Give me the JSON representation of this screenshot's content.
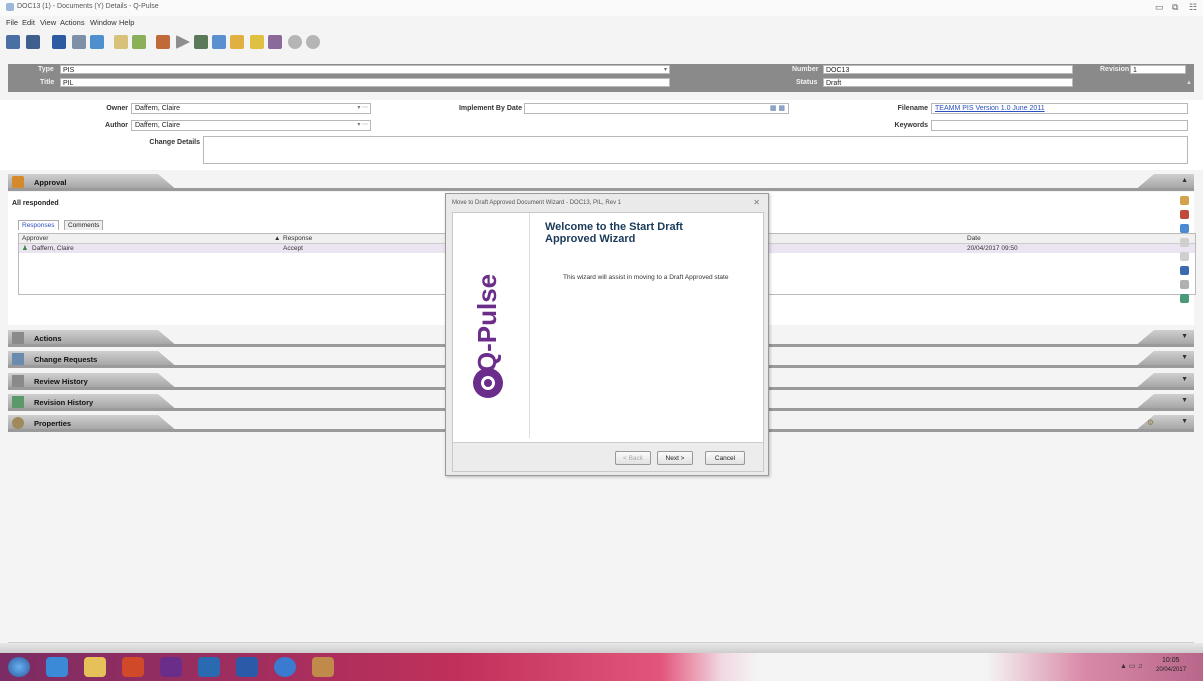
{
  "window": {
    "title": "DOC13 (1) - Documents (Y) Details - Q-Pulse"
  },
  "menu": [
    "File",
    "Edit",
    "View",
    "Actions",
    "Window",
    "Help"
  ],
  "header": {
    "type_label": "Type",
    "type_value": "PIS",
    "title_label": "Title",
    "title_value": "PIL",
    "number_label": "Number",
    "number_value": "DOC13",
    "status_label": "Status",
    "status_value": "Draft",
    "revision_label": "Revision",
    "revision_value": "1"
  },
  "details": {
    "owner_label": "Owner",
    "owner_value": "Daffern, Claire",
    "author_label": "Author",
    "author_value": "Daffern, Claire",
    "implement_label": "Implement By Date",
    "implement_value": "",
    "filename_label": "Filename",
    "filename_value": "TEAMM PIS Version 1.0 June 2011",
    "keywords_label": "Keywords",
    "keywords_value": "",
    "change_label": "Change Details"
  },
  "approval": {
    "title": "Approval",
    "status": "All responded",
    "tabs": [
      "Responses",
      "Comments"
    ],
    "columns": {
      "approver": "Approver",
      "response": "Response",
      "date": "Date"
    },
    "rows": [
      {
        "approver": "Daffern, Claire",
        "response": "Accept",
        "date": "20/04/2017 09:50"
      }
    ]
  },
  "sections": [
    "Actions",
    "Change Requests",
    "Review History",
    "Revision History",
    "Properties"
  ],
  "wizard": {
    "window_title": "Move to Draft Approved Document Wizard - DOC13, PIL, Rev 1",
    "close": "✕",
    "heading": "Welcome to the Start Draft Approved Wizard",
    "body": "This wizard will assist in moving to a Draft Approved state",
    "logo_text": "Q-Pulse",
    "back": "< Back",
    "next": "Next >",
    "cancel": "Cancel"
  },
  "taskbar": {
    "time": "10:05",
    "date": "20/04/2017"
  },
  "colors": {
    "accent": "#6b2d8a",
    "header_bg": "#8a8a8a",
    "selected_row": "#ebe5f2"
  }
}
